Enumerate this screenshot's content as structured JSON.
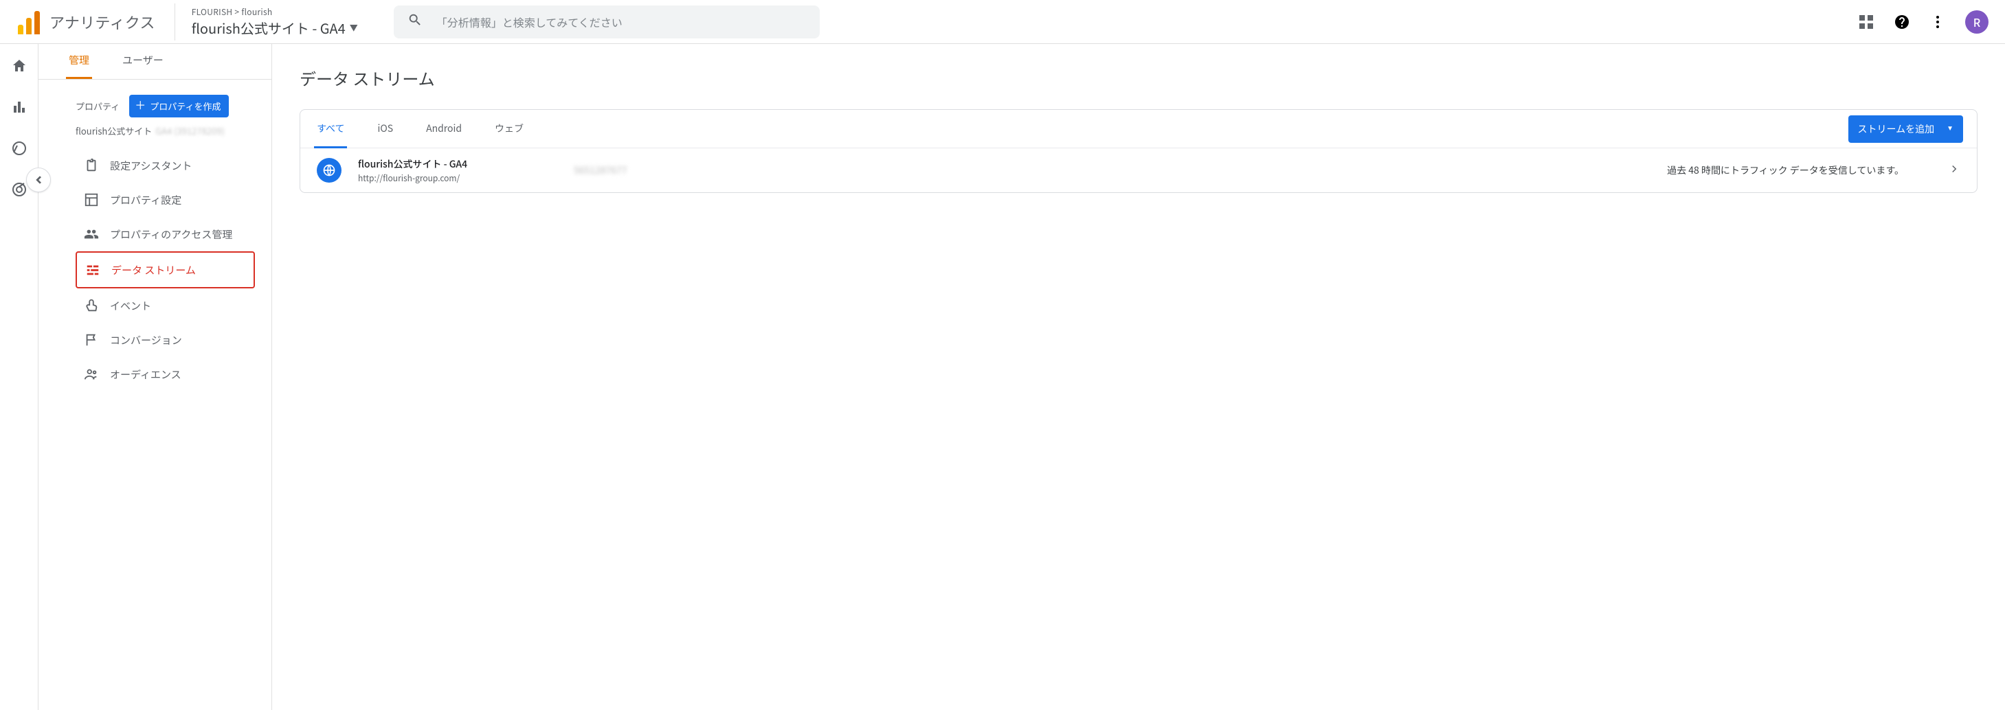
{
  "brand": "アナリティクス",
  "breadcrumb": "FLOURISH > flourish",
  "property_name": "flourish公式サイト - GA4",
  "search_placeholder": "「分析情報」と検索してみてください",
  "avatar_initial": "R",
  "admin_tabs": {
    "active": "管理",
    "inactive": "ユーザー"
  },
  "property_section": {
    "label": "プロパティ",
    "create_button": "プロパティを作成",
    "sub_name": "flourish公式サイト",
    "sub_id": "GA4 (391278209)"
  },
  "nav": {
    "setup_assistant": "設定アシスタント",
    "property_settings": "プロパティ設定",
    "access_mgmt": "プロパティのアクセス管理",
    "data_streams": "データ ストリーム",
    "events": "イベント",
    "conversions": "コンバージョン",
    "audiences": "オーディエンス"
  },
  "page_title": "データ ストリーム",
  "stream_tabs": {
    "all": "すべて",
    "ios": "iOS",
    "android": "Android",
    "web": "ウェブ"
  },
  "add_stream_button": "ストリームを追加",
  "stream_row": {
    "name": "flourish公式サイト - GA4",
    "url": "http://flourish-group.com/",
    "id": "5651287677",
    "status": "過去 48 時間にトラフィック データを受信しています。"
  }
}
